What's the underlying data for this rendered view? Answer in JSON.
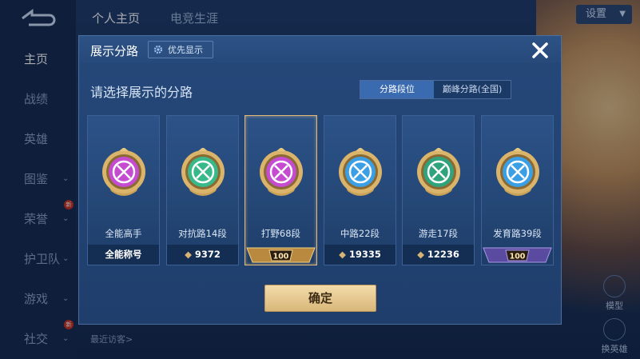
{
  "sidebar": {
    "items": [
      {
        "label": "主页",
        "active": true,
        "chevron": false,
        "badge": ""
      },
      {
        "label": "战绩",
        "active": false,
        "chevron": false,
        "badge": ""
      },
      {
        "label": "英雄",
        "active": false,
        "chevron": false,
        "badge": ""
      },
      {
        "label": "图鉴",
        "active": false,
        "chevron": true,
        "badge": ""
      },
      {
        "label": "荣誉",
        "active": false,
        "chevron": true,
        "badge": "新"
      },
      {
        "label": "护卫队",
        "active": false,
        "chevron": true,
        "badge": ""
      },
      {
        "label": "游戏",
        "active": false,
        "chevron": true,
        "badge": ""
      },
      {
        "label": "社交",
        "active": false,
        "chevron": true,
        "badge": "新"
      }
    ]
  },
  "topbar": {
    "tabs": [
      "个人主页",
      "电竞生涯"
    ],
    "settings_label": "设置"
  },
  "footer": {
    "recent_label": "最近访客>",
    "right_buttons": [
      "模型",
      "换英雄"
    ]
  },
  "modal": {
    "title": "展示分路",
    "priority_label": "优先显示",
    "prompt": "请选择展示的分路",
    "segments": [
      "分路段位",
      "巅峰分路(全国)"
    ],
    "active_segment": 0,
    "confirm_label": "确定",
    "cards": [
      {
        "name": "全能高手",
        "footer": "全能称号",
        "footer_type": "text",
        "color": "#c54bd1",
        "selected": false
      },
      {
        "name": "对抗路14段",
        "footer": "9372",
        "footer_type": "score",
        "color": "#38b98a",
        "selected": false
      },
      {
        "name": "打野68段",
        "footer": "100",
        "footer_type": "plaque-gold",
        "color": "#c54bd1",
        "selected": true
      },
      {
        "name": "中路22段",
        "footer": "19335",
        "footer_type": "score",
        "color": "#3b9fe6",
        "selected": false
      },
      {
        "name": "游走17段",
        "footer": "12236",
        "footer_type": "score",
        "color": "#2fa37c",
        "selected": false
      },
      {
        "name": "发育路39段",
        "footer": "100",
        "footer_type": "plaque-purple",
        "color": "#3b9fe6",
        "selected": false
      }
    ]
  }
}
